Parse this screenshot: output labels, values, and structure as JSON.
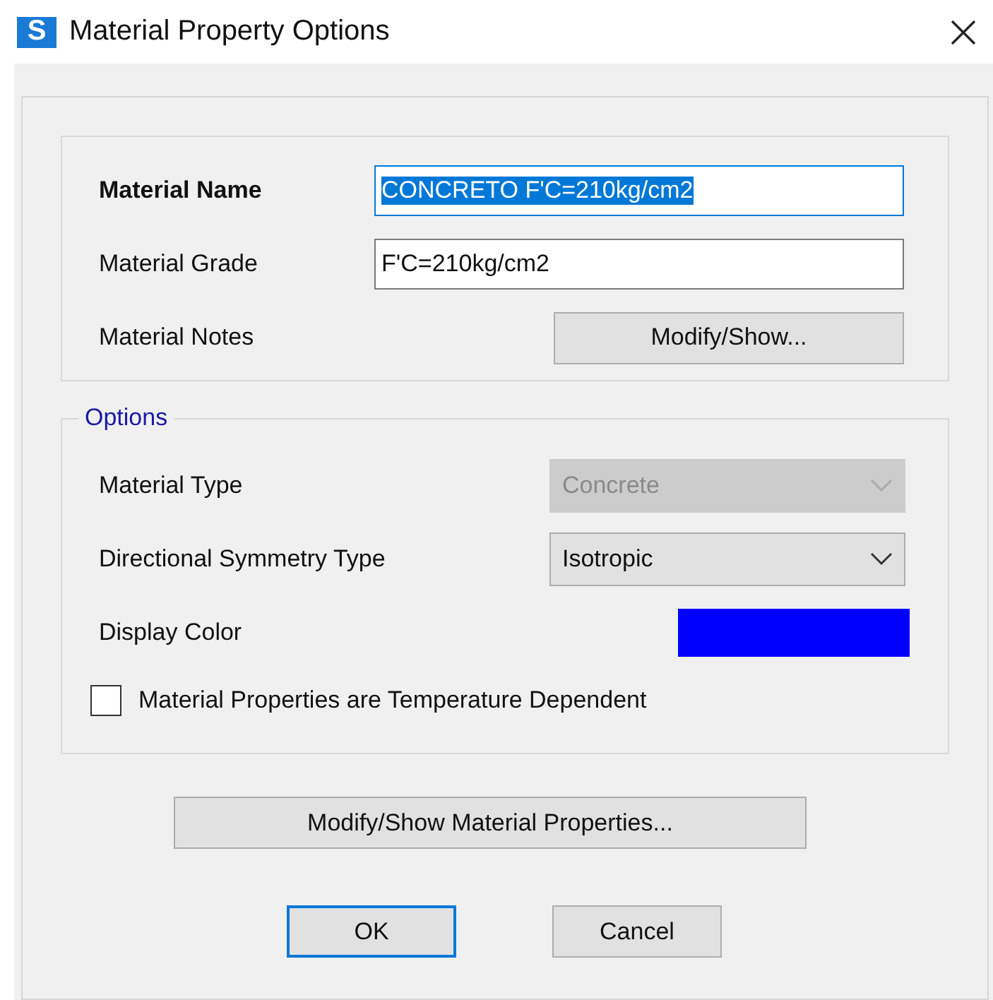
{
  "window": {
    "icon_letter": "S",
    "title": "Material Property Options"
  },
  "general": {
    "fields": [
      {
        "label": "Material Name",
        "kind": "text",
        "value": "CONCRETO F'C=210kg/cm2",
        "text_selected": true,
        "bold": true
      },
      {
        "label": "Material Grade",
        "kind": "text",
        "value": "F'C=210kg/cm2",
        "text_selected": false,
        "bold": false
      },
      {
        "label": "Material Notes",
        "kind": "button",
        "value": "Modify/Show...",
        "bold": false
      }
    ]
  },
  "options": {
    "title": "Options",
    "fields": [
      {
        "label": "Material Type",
        "kind": "dropdown",
        "value": "Concrete",
        "disabled": true
      },
      {
        "label": "Directional Symmetry Type",
        "kind": "dropdown",
        "value": "Isotropic",
        "disabled": false
      },
      {
        "label": "Display Color",
        "kind": "color",
        "color": "#0000ff"
      }
    ],
    "checkbox": {
      "label": "Material Properties are Temperature Dependent",
      "checked": false
    }
  },
  "properties_button": "Modify/Show Material Properties...",
  "buttons": [
    {
      "label": "OK",
      "default": true
    },
    {
      "label": "Cancel",
      "default": false
    }
  ]
}
